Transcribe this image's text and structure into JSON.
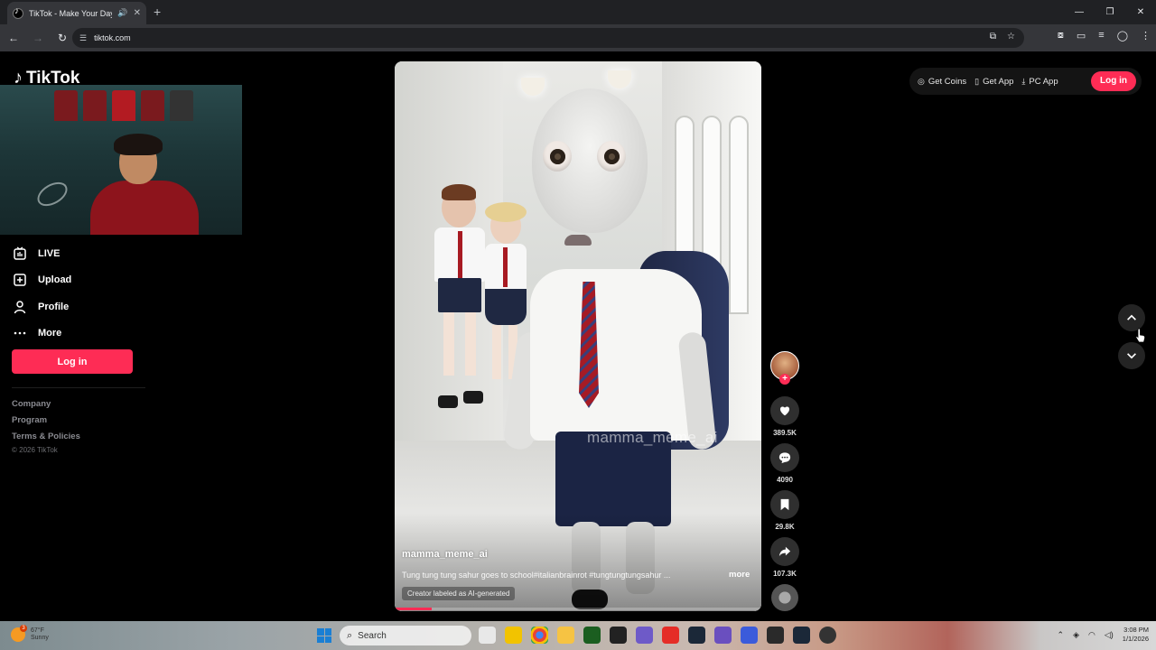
{
  "browser": {
    "tab_title": "TikTok - Make Your Day",
    "url": "tiktok.com"
  },
  "sidebar": {
    "logo_text": "TikTok",
    "nav": [
      {
        "label": "LIVE",
        "icon": "live-icon"
      },
      {
        "label": "Upload",
        "icon": "upload-icon"
      },
      {
        "label": "Profile",
        "icon": "profile-icon"
      },
      {
        "label": "More",
        "icon": "more-icon"
      }
    ],
    "login_label": "Log in",
    "footer_links": [
      "Company",
      "Program",
      "Terms & Policies"
    ],
    "copyright": "© 2026 TikTok"
  },
  "header": {
    "get_coins": "Get Coins",
    "get_app": "Get App",
    "pc_app": "PC App",
    "login_label": "Log in"
  },
  "video": {
    "watermark": "mamma_meme_ai",
    "author": "mamma_meme_ai",
    "description": "Tung tung tung sahur goes to school#italianbrainrot #tungtungtungsahur ...",
    "more_label": "more",
    "ai_label": "Creator labeled as AI-generated",
    "progress": 0.1
  },
  "actions": {
    "likes": "389.5K",
    "comments": "4090",
    "saves": "29.8K",
    "shares": "107.3K"
  },
  "taskbar": {
    "weather_temp": "67°F",
    "weather_cond": "Sunny",
    "weather_badge": "3",
    "search_placeholder": "Search",
    "time": "3:08 PM",
    "date": "1/1/2026"
  },
  "colors": {
    "brand": "#fe2c55",
    "background": "#000000"
  }
}
